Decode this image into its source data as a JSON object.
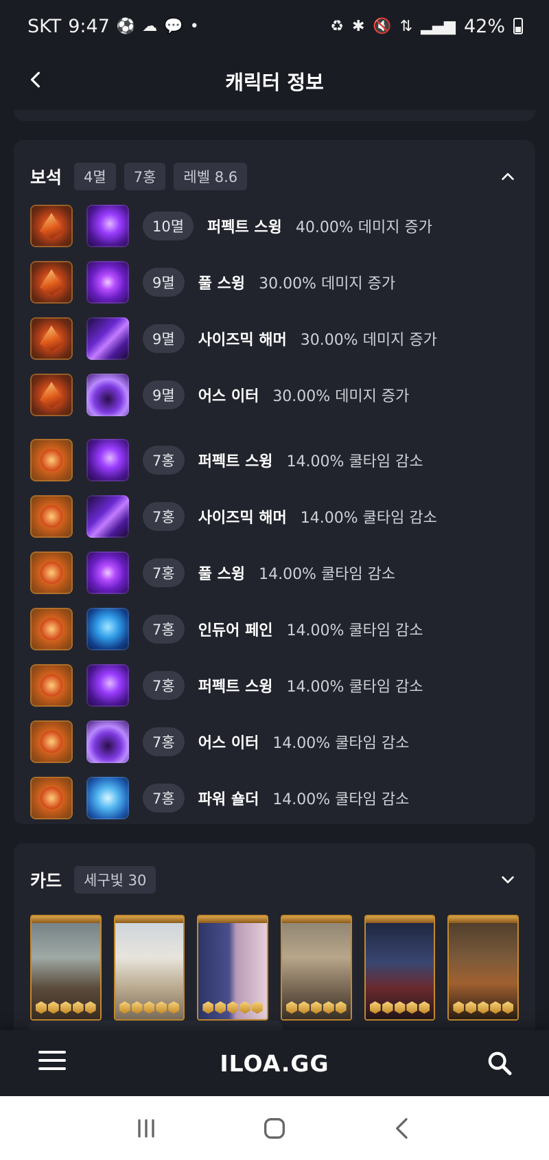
{
  "status_bar": {
    "carrier": "SKT",
    "time": "9:47",
    "battery": "42%"
  },
  "header": {
    "title": "캐릭터 정보"
  },
  "jewels": {
    "title": "보석",
    "chips": [
      "4멸",
      "7홍",
      "레벨 8.6"
    ],
    "items": [
      {
        "type": "myeol",
        "skill_style": "purple",
        "level": "10멸",
        "skill": "퍼펙트 스윙",
        "effect": "40.00% 데미지 증가"
      },
      {
        "type": "myeol",
        "skill_style": "swirl",
        "level": "9멸",
        "skill": "풀 스윙",
        "effect": "30.00% 데미지 증가"
      },
      {
        "type": "myeol",
        "skill_style": "slash",
        "level": "9멸",
        "skill": "사이즈믹 해머",
        "effect": "30.00% 데미지 증가"
      },
      {
        "type": "myeol",
        "skill_style": "earth",
        "level": "9멸",
        "skill": "어스 이터",
        "effect": "30.00% 데미지 증가"
      },
      {
        "type": "hong",
        "skill_style": "purple",
        "level": "7홍",
        "skill": "퍼펙트 스윙",
        "effect": "14.00% 쿨타임 감소"
      },
      {
        "type": "hong",
        "skill_style": "slash",
        "level": "7홍",
        "skill": "사이즈믹 해머",
        "effect": "14.00% 쿨타임 감소"
      },
      {
        "type": "hong",
        "skill_style": "swirl",
        "level": "7홍",
        "skill": "풀 스윙",
        "effect": "14.00% 쿨타임 감소"
      },
      {
        "type": "hong",
        "skill_style": "blue",
        "level": "7홍",
        "skill": "인듀어 페인",
        "effect": "14.00% 쿨타임 감소"
      },
      {
        "type": "hong",
        "skill_style": "purple",
        "level": "7홍",
        "skill": "퍼펙트 스윙",
        "effect": "14.00% 쿨타임 감소"
      },
      {
        "type": "hong",
        "skill_style": "earth",
        "level": "7홍",
        "skill": "어스 이터",
        "effect": "14.00% 쿨타임 감소"
      },
      {
        "type": "hong",
        "skill_style": "shield",
        "level": "7홍",
        "skill": "파워 숄더",
        "effect": "14.00% 쿨타임 감소"
      }
    ]
  },
  "cards": {
    "title": "카드",
    "chip": "세구빛 30",
    "items": [
      {
        "art": "art1"
      },
      {
        "art": "art2"
      },
      {
        "art": "art3"
      },
      {
        "art": "art4"
      },
      {
        "art": "art5"
      },
      {
        "art": "art6"
      }
    ]
  },
  "bottom_bar": {
    "logo": "ILOA.GG"
  },
  "colors": {
    "background": "#1a1c24",
    "card": "#22242d",
    "chip": "#333642",
    "card_frame": "#c38a2e"
  }
}
